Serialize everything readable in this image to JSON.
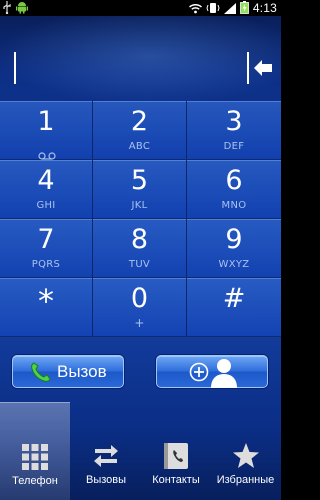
{
  "status_bar": {
    "time": "4:13",
    "icons": [
      "usb-icon",
      "android-debug-icon",
      "wifi-icon",
      "vibrate-icon",
      "signal-icon",
      "battery-charging-icon"
    ]
  },
  "display": {
    "number": "",
    "backspace_icon": "backspace-arrow-icon"
  },
  "keypad": [
    {
      "digit": "1",
      "letters": "",
      "extra_icon": "voicemail-icon"
    },
    {
      "digit": "2",
      "letters": "ABC"
    },
    {
      "digit": "3",
      "letters": "DEF"
    },
    {
      "digit": "4",
      "letters": "GHI"
    },
    {
      "digit": "5",
      "letters": "JKL"
    },
    {
      "digit": "6",
      "letters": "MNO"
    },
    {
      "digit": "7",
      "letters": "PQRS"
    },
    {
      "digit": "8",
      "letters": "TUV"
    },
    {
      "digit": "9",
      "letters": "WXYZ"
    },
    {
      "digit": "*",
      "letters": ""
    },
    {
      "digit": "0",
      "letters": "+"
    },
    {
      "digit": "#",
      "letters": ""
    }
  ],
  "actions": {
    "call_label": "Вызов",
    "call_icon": "phone-icon",
    "add_contact_icon": "add-contact-icon"
  },
  "tabs": [
    {
      "label": "Телефон",
      "icon": "dialpad-icon",
      "active": true
    },
    {
      "label": "Вызовы",
      "icon": "call-log-icon",
      "active": false
    },
    {
      "label": "Контакты",
      "icon": "contacts-icon",
      "active": false
    },
    {
      "label": "Избранные",
      "icon": "star-icon",
      "active": false
    }
  ],
  "colors": {
    "accent": "#2f6fdc",
    "call_green": "#3bc43b"
  }
}
